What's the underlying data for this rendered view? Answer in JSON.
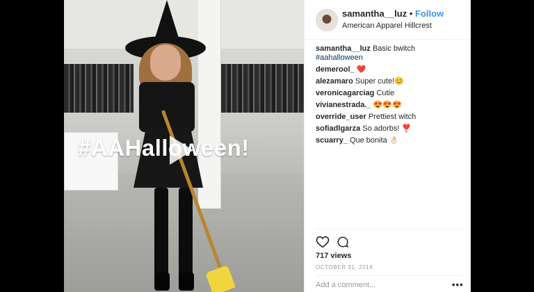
{
  "post": {
    "overlay_text": "#AAHalloween!",
    "author": "samantha__luz",
    "follow_label": "Follow",
    "location": "American Apparel Hillcrest",
    "caption_text": "Basic bwitch",
    "caption_hashtag": "#aahalloween",
    "comments": [
      {
        "user": "demerool_",
        "text": "❤️"
      },
      {
        "user": "alezamaro",
        "text": "Super cute!😊"
      },
      {
        "user": "veronicagarciag",
        "text": "Cutie"
      },
      {
        "user": "vivianestrada._",
        "text": "😍😍😍"
      },
      {
        "user": "override_user",
        "text": "Prettiest witch"
      },
      {
        "user": "sofiadlgarza",
        "text": "So adorbs! ❣️"
      },
      {
        "user": "scuarry_",
        "text": "Que bonita 👌🏻"
      }
    ],
    "views": "717 views",
    "date": "OCTOBER 31, 2016",
    "add_comment_placeholder": "Add a comment...",
    "more_label": "•••",
    "colors": {
      "link": "#003569",
      "follow": "#3897f0",
      "text": "#262626"
    }
  }
}
